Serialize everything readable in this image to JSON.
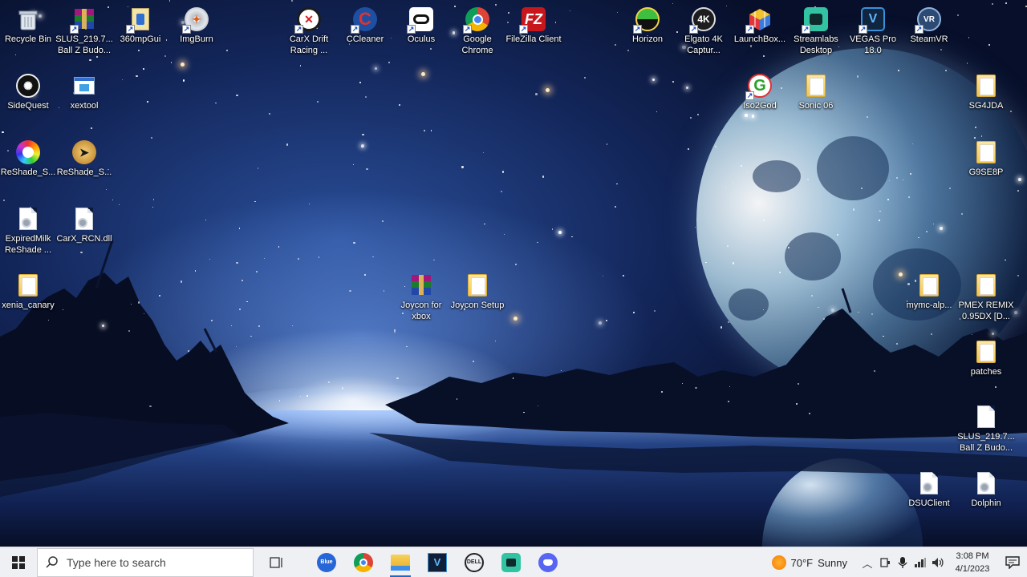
{
  "desktop": {
    "icons": [
      {
        "label": "Recycle Bin",
        "icon": "recycle-bin-icon"
      },
      {
        "label": "SLUS_219.7... Ball Z Budo...",
        "icon": "winrar-archive-icon"
      },
      {
        "label": "360mpGui",
        "icon": "360mpgui-icon"
      },
      {
        "label": "ImgBurn",
        "icon": "imgburn-icon"
      },
      {
        "label": "CarX Drift Racing ...",
        "icon": "carx-icon"
      },
      {
        "label": "CCleaner",
        "icon": "ccleaner-icon"
      },
      {
        "label": "Oculus",
        "icon": "oculus-icon"
      },
      {
        "label": "Google Chrome",
        "icon": "chrome-icon"
      },
      {
        "label": "FileZilla Client",
        "icon": "filezilla-icon"
      },
      {
        "label": "Horizon",
        "icon": "horizon-icon"
      },
      {
        "label": "Elgato 4K Captur...",
        "icon": "elgato-icon"
      },
      {
        "label": "LaunchBox...",
        "icon": "launchbox-icon"
      },
      {
        "label": "Streamlabs Desktop",
        "icon": "streamlabs-icon"
      },
      {
        "label": "VEGAS Pro 18.0",
        "icon": "vegas-icon"
      },
      {
        "label": "SteamVR",
        "icon": "steamvr-icon"
      },
      {
        "label": "SideQuest",
        "icon": "sidequest-icon"
      },
      {
        "label": "xextool",
        "icon": "xextool-icon"
      },
      {
        "label": "Iso2God",
        "icon": "iso2god-icon"
      },
      {
        "label": "Sonic 06",
        "icon": "folder-icon"
      },
      {
        "label": "SG4JDA",
        "icon": "folder-icon"
      },
      {
        "label": "ReShade_S...",
        "icon": "reshade-icon"
      },
      {
        "label": "ReShade_S...",
        "icon": "reshade-setup-icon"
      },
      {
        "label": "G9SE8P",
        "icon": "folder-icon"
      },
      {
        "label": "ExpiredMilk ReShade ...",
        "icon": "file-icon"
      },
      {
        "label": "CarX_RCN.dll",
        "icon": "dll-file-icon"
      },
      {
        "label": "xenia_canary",
        "icon": "folder-icon"
      },
      {
        "label": "Joycon for xbox",
        "icon": "winrar-archive-icon"
      },
      {
        "label": "Joycon Setup",
        "icon": "folder-icon"
      },
      {
        "label": "mymc-alp...",
        "icon": "folder-icon"
      },
      {
        "label": "PMEX REMIX 0.95DX [D...",
        "icon": "folder-icon"
      },
      {
        "label": "patches",
        "icon": "folder-icon"
      },
      {
        "label": "SLUS_219.7... Ball Z Budo...",
        "icon": "file-icon"
      },
      {
        "label": "DSUClient",
        "icon": "settings-file-icon"
      },
      {
        "label": "Dolphin",
        "icon": "settings-file-icon"
      }
    ]
  },
  "taskbar": {
    "search_placeholder": "Type here to search",
    "apps": [
      {
        "name": "task-view-icon"
      },
      {
        "name": "bluestacks-icon"
      },
      {
        "name": "chrome-icon"
      },
      {
        "name": "file-explorer-icon"
      },
      {
        "name": "vegas-icon"
      },
      {
        "name": "dell-icon"
      },
      {
        "name": "streamlabs-icon"
      },
      {
        "name": "discord-icon"
      }
    ],
    "weather": {
      "temp": "70°F",
      "condition": "Sunny"
    },
    "clock": {
      "time": "3:08 PM",
      "date": "4/1/2023"
    },
    "colors": {
      "accent": "#1b6ac9",
      "taskbar_bg": "#eef0f4"
    }
  }
}
